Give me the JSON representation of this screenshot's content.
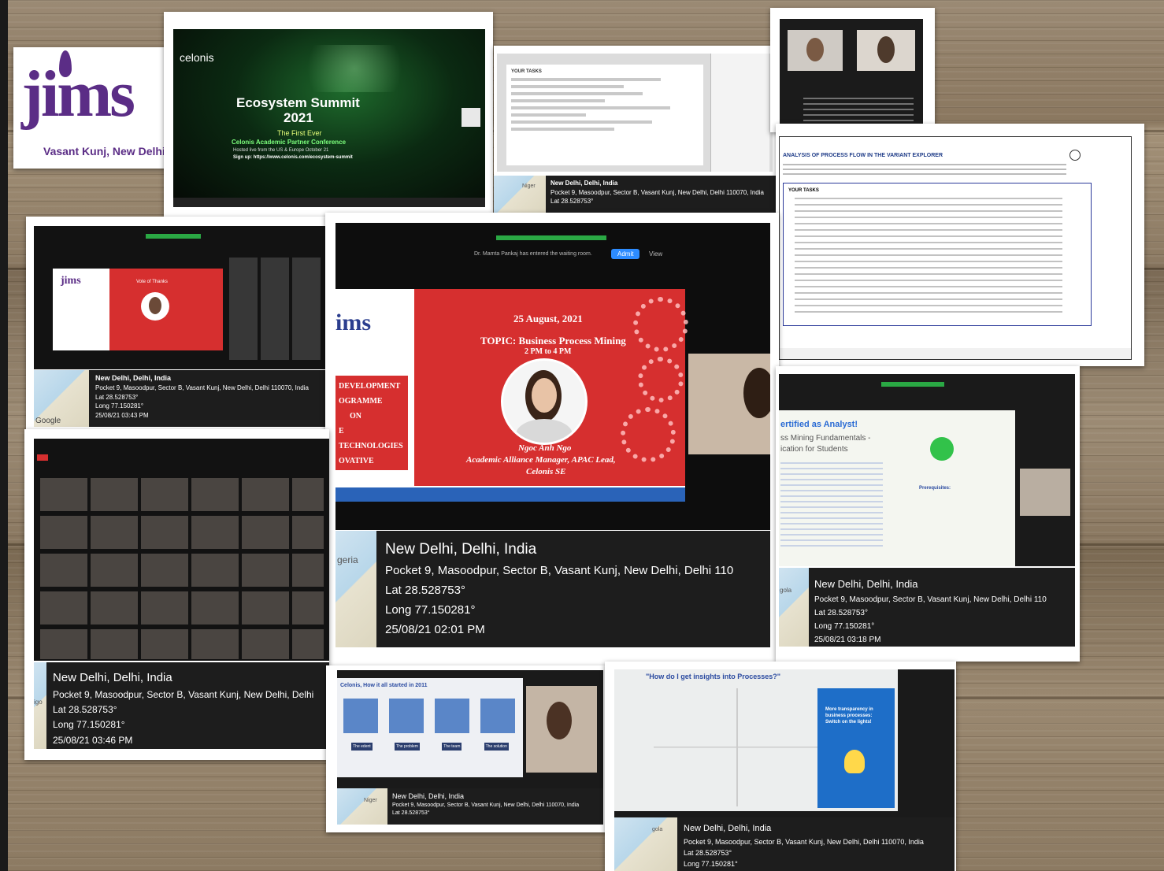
{
  "logo": {
    "text": "jims",
    "subtitle": "Vasant Kunj, New Delhi",
    "brand_color": "#5b2d86"
  },
  "summit": {
    "brand": "celonis",
    "title_line1": "Ecosystem Summit",
    "title_line2": "2021",
    "tagline": "The First Ever",
    "subtitle": "Celonis Academic Partner Conference",
    "line_small": "Hosted live from the US & Europe October 21",
    "signup": "Sign up: https://www.celonis.com/ecosystem-summit"
  },
  "geotags": [
    {
      "city": "New Delhi, Delhi, India",
      "address": "Pocket 9, Masoodpur, Sector B, Vasant Kunj, New Delhi, Delhi 110070, India",
      "lat": "Lat 28.528753°",
      "long": "",
      "date": "",
      "map_label": "Niger"
    },
    {
      "city": "New Delhi, Delhi, India",
      "address": "Pocket 9, Masoodpur, Sector B, Vasant Kunj, New Delhi, Delhi 110070, India",
      "lat": "Lat 28.528753°",
      "long": "Long 77.150281°",
      "date": "25/08/21 03:43 PM",
      "map_label": "Niger"
    },
    {
      "city": "New Delhi, Delhi, India",
      "address": "Pocket 9, Masoodpur, Sector B, Vasant Kunj, New Delhi, Delhi 110",
      "lat": "Lat 28.528753°",
      "long": "Long 77.150281°",
      "date": "25/08/21 02:01 PM",
      "map_label": "geria"
    },
    {
      "city": "New Delhi, Delhi, India",
      "address": "Pocket 9, Masoodpur, Sector B, Vasant Kunj, New Delhi, Delhi 110",
      "lat": "Lat 28.528753°",
      "long": "Long 77.150281°",
      "date": "25/08/21 03:18 PM",
      "map_label": "gola"
    },
    {
      "city": "New Delhi, Delhi, India",
      "address": "Pocket 9, Masoodpur, Sector B, Vasant Kunj, New Delhi, Delhi",
      "lat": "Lat 28.528753°",
      "long": "Long 77.150281°",
      "date": "25/08/21 03:46 PM",
      "map_label": "igo"
    },
    {
      "city": "New Delhi, Delhi, India",
      "address": "Pocket 9, Masoodpur, Sector B, Vasant Kunj, New Delhi, Delhi 110070, India",
      "lat": "Lat 28.528753°",
      "long": "",
      "date": "",
      "map_label": "Niger"
    },
    {
      "city": "New Delhi, Delhi, India",
      "address": "Pocket 9, Masoodpur, Sector B, Vasant Kunj, New Delhi, Delhi 110070, India",
      "lat": "Lat 28.528753°",
      "long": "Long 77.150281°",
      "date": "",
      "map_label": "gola"
    }
  ],
  "center_slide": {
    "date": "25 August, 2021",
    "topic": "TOPIC: Business Process Mining",
    "time": "2 PM to 4 PM",
    "left_text": [
      "DEVELOPMENT",
      "OGRAMME",
      "ON",
      "E TECHNOLOGIES",
      "OVATIVE SOLUTIONS"
    ],
    "speaker_name": "Ngoc Anh Ngo",
    "speaker_role": "Academic Alliance Manager, APAC Lead,",
    "speaker_org": "Celonis SE",
    "logo_fragment": "ims",
    "admit_button": "Admit",
    "view_button": "View",
    "waiting_note": "Dr. Mamta Pankaj has entered the waiting room."
  },
  "left_slide": {
    "logo": "jims",
    "thanks": "Vote of Thanks"
  },
  "analysis_doc": {
    "heading": "ANALYSIS OF PROCESS FLOW IN THE VARIANT EXPLORER",
    "tasks_label": "YOUR TASKS"
  },
  "small_doc": {
    "tasks_label": "YOUR TASKS"
  },
  "analyst_slide": {
    "title": "ertified as Analyst!",
    "sub1": "ss Mining Fundamentals -",
    "sub2": "ication for Students",
    "prereq": "Prerequisites:"
  },
  "story_slide": {
    "title": "Celonis, How it all started in 2011",
    "labels": [
      "The edent",
      "The problem",
      "The team",
      "The solution"
    ]
  },
  "insights_slide": {
    "title": "\"How do I get insights into Processes?\"",
    "blue_text": "More transparency in business processes: Switch on the lights!"
  },
  "map_credit": "Google",
  "colors": {
    "slide_red": "#d62f2f",
    "geo_bg": "#0f0f0f",
    "zoom_green": "#2aa844",
    "insight_blue": "#1e6ec8",
    "doc_heading": "#1f3c88"
  }
}
